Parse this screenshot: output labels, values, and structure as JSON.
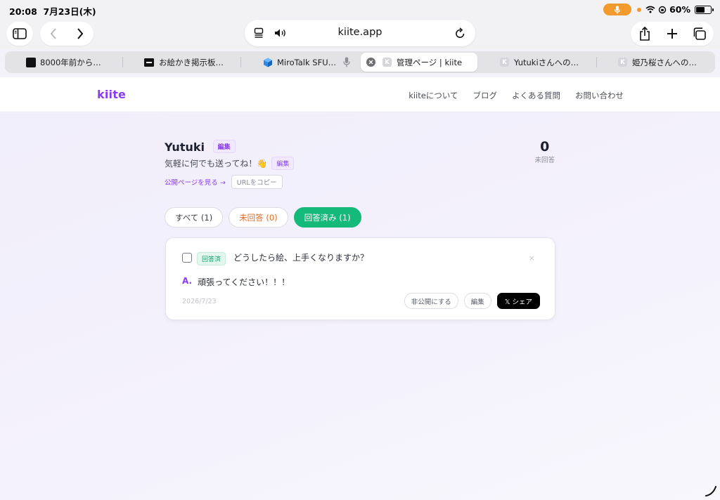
{
  "status_bar": {
    "time": "20:08",
    "date": "7月23日(木)",
    "battery": "60%",
    "battery_level": 0.6
  },
  "browser": {
    "url": "kiite.app"
  },
  "tabs": [
    {
      "label": "8000年前から…",
      "icon": "moon-icon"
    },
    {
      "label": "お絵かき掲示板…",
      "icon": "black-square-icon"
    },
    {
      "label": "MiroTalk SFU…",
      "icon": "cube-icon"
    },
    {
      "label": "管理ページ | kiite",
      "icon": "k-icon",
      "active": true
    },
    {
      "label": "Yutukiさんへの…",
      "icon": "k-icon"
    },
    {
      "label": "姫乃桜さんへの…",
      "icon": "k-icon"
    }
  ],
  "site": {
    "logo": "kiite",
    "nav": [
      "kiiteについて",
      "ブログ",
      "よくある質問",
      "お問い合わせ"
    ]
  },
  "profile": {
    "name": "Yutuki",
    "edit_label": "編集",
    "bio": "気軽に何でも送ってね！👋",
    "public_link": "公開ページを見る →",
    "copy_url": "URLをコピー",
    "unanswered_count": "0",
    "unanswered_label": "未回答"
  },
  "filters": [
    {
      "label": "すべて (1)"
    },
    {
      "label": "未回答 (0)"
    },
    {
      "label": "回答済み (1)"
    }
  ],
  "question_card": {
    "badge": "回答済",
    "question": "どうしたら絵、上手くなりますか？",
    "answer_prefix": "A.",
    "answer": "頑張ってください！！！",
    "date": "2026/7/23",
    "close": "×",
    "actions": {
      "hide": "非公開にする",
      "edit": "編集",
      "share": "𝕏 シェア"
    }
  }
}
